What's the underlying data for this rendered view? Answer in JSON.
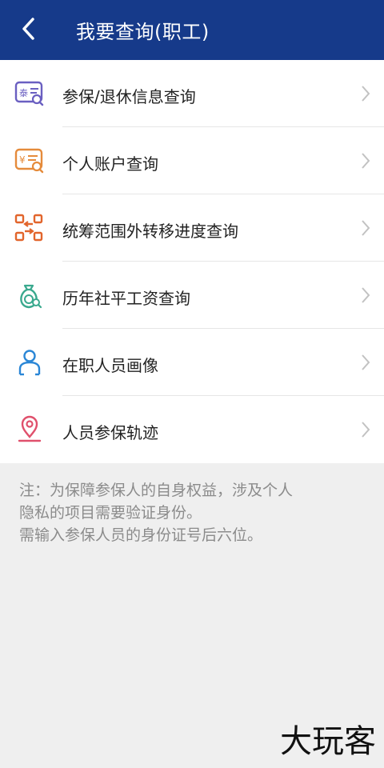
{
  "header": {
    "title": "我要查询(职工)",
    "bg_color": "#163a8a"
  },
  "menu": {
    "items": [
      {
        "label": "参保/退休信息查询",
        "icon": "id-card-search-icon",
        "color": "#6a5fc1"
      },
      {
        "label": "个人账户查询",
        "icon": "yuan-account-search-icon",
        "color": "#e58b3b"
      },
      {
        "label": "统筹范围外转移进度查询",
        "icon": "transfer-arrows-icon",
        "color": "#e2652c"
      },
      {
        "label": "历年社平工资查询",
        "icon": "money-bag-icon",
        "color": "#3aa98e"
      },
      {
        "label": "在职人员画像",
        "icon": "person-icon",
        "color": "#2a86d6"
      },
      {
        "label": "人员参保轨迹",
        "icon": "location-pin-icon",
        "color": "#e0506c"
      }
    ]
  },
  "note": {
    "line1": "注：为保障参保人的自身权益，涉及个人",
    "line2": "隐私的项目需要验证身份。",
    "line3": "需输入参保人员的身份证号后六位。"
  },
  "watermark": {
    "text": "大玩客"
  }
}
